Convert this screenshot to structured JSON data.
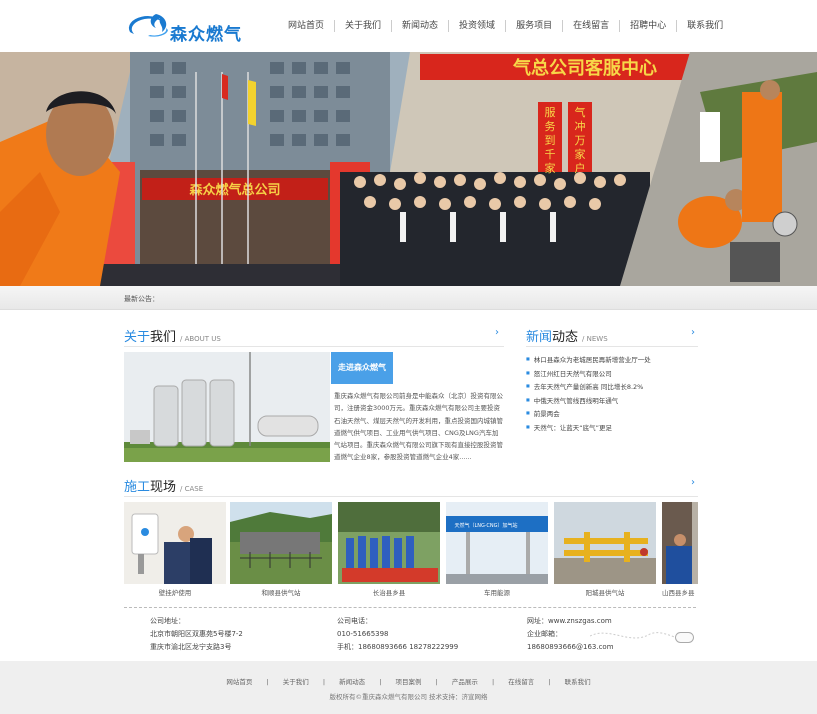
{
  "brand": {
    "name": "森众燃气",
    "logo_color": "#1a7ad0"
  },
  "nav": [
    "网站首页",
    "关于我们",
    "新闻动态",
    "投资领域",
    "服务项目",
    "在线留言",
    "招聘中心",
    "联系我们"
  ],
  "banner": {
    "banner_sign": "气总公司客服中心",
    "building_sign": "森众燃气总公司",
    "couplet_left": "服务到千家",
    "couplet_right": "气冲万家户",
    "slide_count": 4,
    "active_slide": 0
  },
  "notice": {
    "label": "最新公告："
  },
  "about": {
    "title_hl": "关于",
    "title_rest": "我们",
    "title_en": "/ ABOUT  US",
    "tag": "走进森众燃气",
    "text": "重庆森众燃气有限公司前身是中能森众（北京）投资有限公司，注册资金3000万元。重庆森众燃气有限公司主要投资石油天然气、煤层天然气的开发利用，重点投资国内城镇管道燃气供气项目、工业用气供气项目、CNG及LNG汽车加气站项目。重庆森众燃气有限公司旗下现有直接控股投资管道燃气企业8家，参股投资管道燃气企业4家......"
  },
  "news": {
    "title_hl": "新闻",
    "title_rest": "动态",
    "title_en": "/ NEWS",
    "items": [
      "林口县森众为老城居民再新增营业厅一处",
      "怒江州红日天然气有限公司",
      "去年天然气产量创新高 同比增长8.2%",
      "中俄天然气管线西线明年通气",
      "前景两会",
      "天然气：让蓝天“底气”更足"
    ]
  },
  "cases": {
    "title_hl": "施工",
    "title_rest": "现场",
    "title_en": "/ CASE",
    "items": [
      {
        "label": "壁挂炉使用"
      },
      {
        "label": "和顺县供气站"
      },
      {
        "label": "长治县乡县"
      },
      {
        "label": "车用能源",
        "station_sign": "天然气（LNG·CNG）加气站"
      },
      {
        "label": "阳城县供气站"
      },
      {
        "label": "山西县乡县"
      }
    ]
  },
  "contact": {
    "address_label": "公司地址：",
    "address1": "北京市朝阳区双惠苑5号楼7-2",
    "address2": "重庆市渝北区龙宁支路3号",
    "phone_label": "公司电话：",
    "phone": "010-51665398",
    "mobile": "手机：18680893666   18278222999",
    "site": "网址：www.znszgas.com",
    "email_label": "企业邮箱：",
    "email": "18680893666@163.com"
  },
  "footer": {
    "links": [
      "网站首页",
      "|",
      "关于我们",
      "|",
      "新闻动态",
      "|",
      "项目案例",
      "|",
      "产品展示",
      "|",
      "在线留言",
      "|",
      "联系我们"
    ],
    "copyright": "版权所有©重庆森众燃气有限公司   技术支持：济宣网络"
  },
  "colors": {
    "accent": "#2a8be0",
    "banner_red": "#d8261c"
  }
}
